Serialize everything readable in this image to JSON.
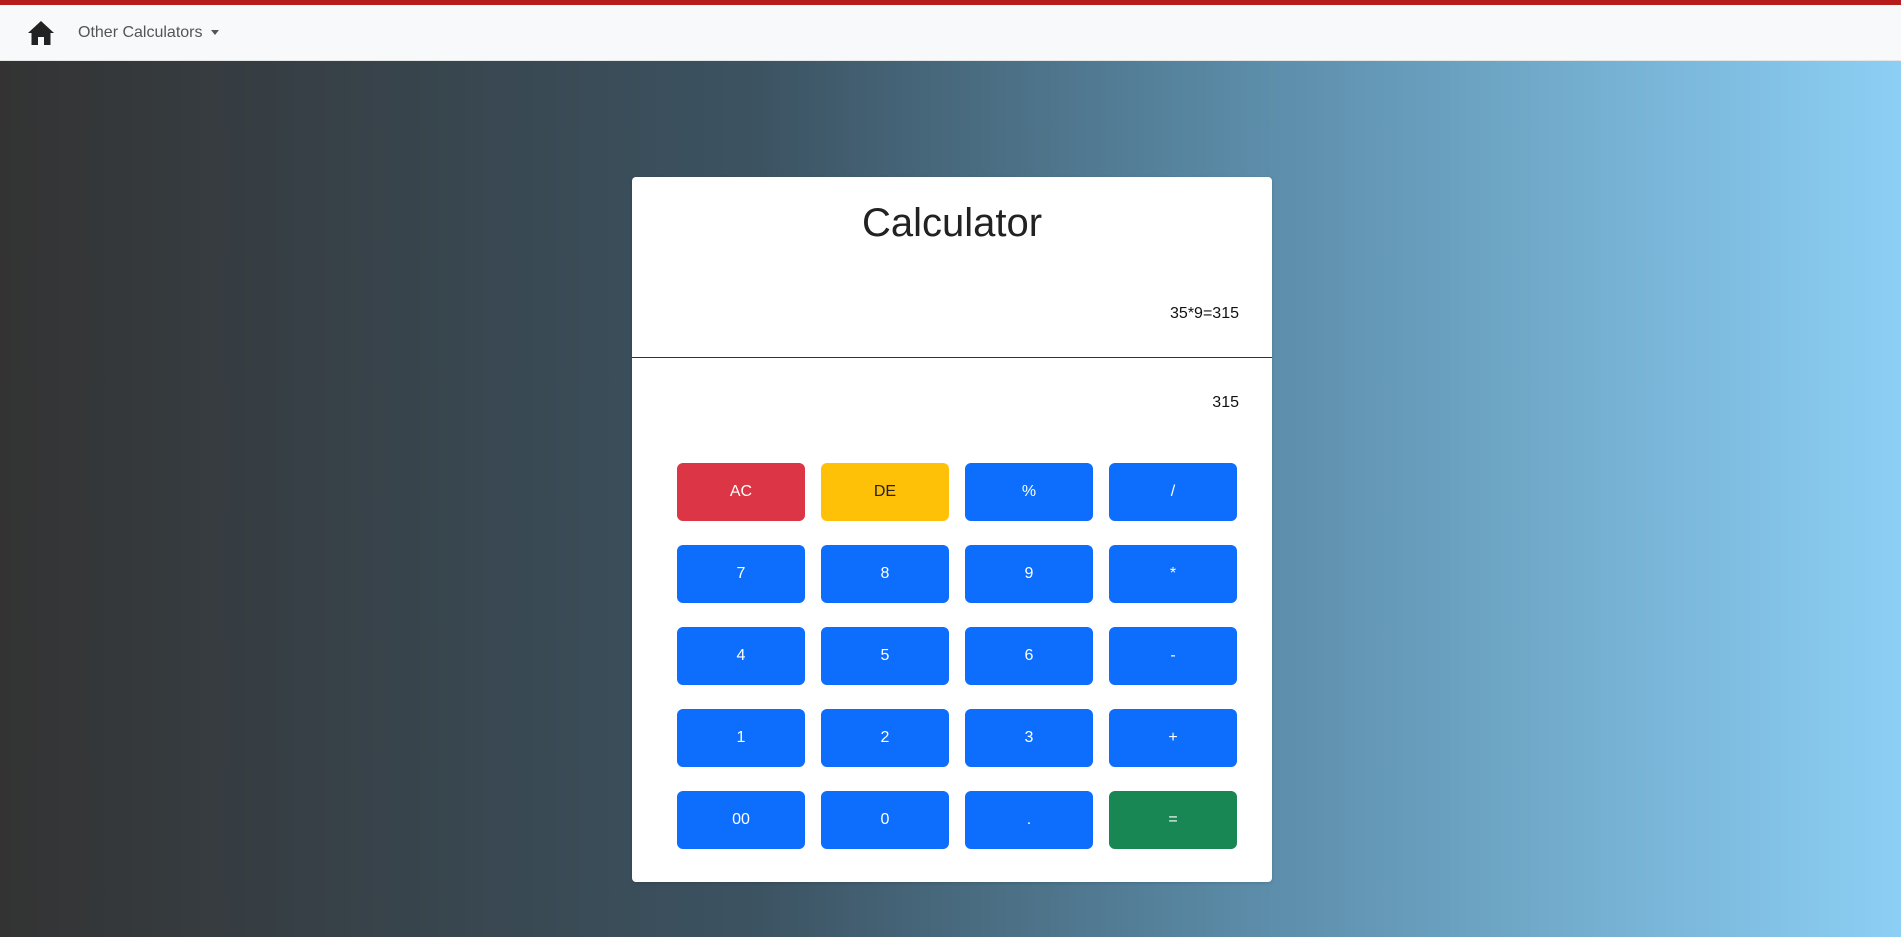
{
  "nav": {
    "home_icon": "home-icon",
    "dropdown_label": "Other Calculators"
  },
  "calculator": {
    "title": "Calculator",
    "expression": "35*9=315",
    "result": "315",
    "keys": [
      {
        "label": "AC",
        "style": "danger",
        "name": "clear-button"
      },
      {
        "label": "DE",
        "style": "warning",
        "name": "delete-button"
      },
      {
        "label": "%",
        "style": "primary",
        "name": "percent-button"
      },
      {
        "label": "/",
        "style": "primary",
        "name": "divide-button"
      },
      {
        "label": "7",
        "style": "primary",
        "name": "digit-7-button"
      },
      {
        "label": "8",
        "style": "primary",
        "name": "digit-8-button"
      },
      {
        "label": "9",
        "style": "primary",
        "name": "digit-9-button"
      },
      {
        "label": "*",
        "style": "primary",
        "name": "multiply-button"
      },
      {
        "label": "4",
        "style": "primary",
        "name": "digit-4-button"
      },
      {
        "label": "5",
        "style": "primary",
        "name": "digit-5-button"
      },
      {
        "label": "6",
        "style": "primary",
        "name": "digit-6-button"
      },
      {
        "label": "-",
        "style": "primary",
        "name": "subtract-button"
      },
      {
        "label": "1",
        "style": "primary",
        "name": "digit-1-button"
      },
      {
        "label": "2",
        "style": "primary",
        "name": "digit-2-button"
      },
      {
        "label": "3",
        "style": "primary",
        "name": "digit-3-button"
      },
      {
        "label": "+",
        "style": "primary",
        "name": "add-button"
      },
      {
        "label": "00",
        "style": "primary",
        "name": "double-zero-button"
      },
      {
        "label": "0",
        "style": "primary",
        "name": "digit-0-button"
      },
      {
        "label": ".",
        "style": "primary",
        "name": "decimal-button"
      },
      {
        "label": "=",
        "style": "success",
        "name": "equals-button"
      }
    ]
  },
  "colors": {
    "accent_bar": "#b71c1c",
    "primary": "#0d6efd",
    "danger": "#dc3545",
    "warning": "#ffc107",
    "success": "#198754"
  }
}
